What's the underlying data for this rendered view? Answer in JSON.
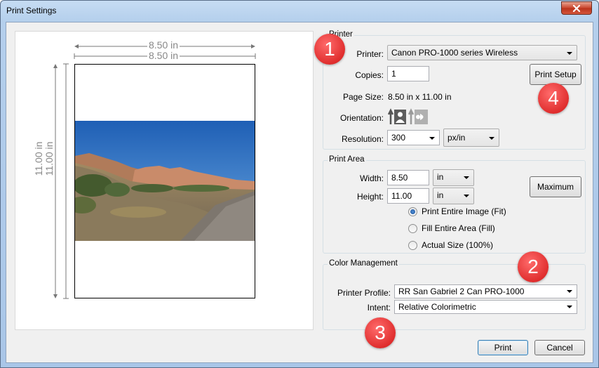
{
  "window": {
    "title": "Print Settings"
  },
  "preview": {
    "width_label": "8.50 in",
    "width_label_2": "8.50 in",
    "height_label": "11.00 in",
    "height_label_2": "11.00 in"
  },
  "printer_group": {
    "label": "Printer",
    "printer_label": "Printer:",
    "printer_value": "Canon PRO-1000 series Wireless",
    "copies_label": "Copies:",
    "copies_value": "1",
    "page_size_label": "Page Size:",
    "page_size_value": "8.50 in x 11.00 in",
    "orientation_label": "Orientation:",
    "resolution_label": "Resolution:",
    "resolution_value": "300",
    "resolution_unit": "px/in",
    "print_setup_button": "Print Setup"
  },
  "print_area": {
    "label": "Print Area",
    "width_label": "Width:",
    "width_value": "8.50",
    "width_unit": "in",
    "height_label": "Height:",
    "height_value": "11.00",
    "height_unit": "in",
    "maximum_button": "Maximum",
    "options": [
      "Print Entire Image (Fit)",
      "Fill Entire Area (Fill)",
      "Actual Size (100%)"
    ],
    "selected": 0
  },
  "color_management": {
    "label": "Color Management",
    "profile_label": "Printer Profile:",
    "profile_value": "RR San Gabriel 2 Can PRO-1000",
    "intent_label": "Intent:",
    "intent_value": "Relative Colorimetric"
  },
  "buttons": {
    "print": "Print",
    "cancel": "Cancel"
  },
  "badges": [
    "1",
    "2",
    "3",
    "4"
  ],
  "colors": {
    "badge": "#e02e2e",
    "title_bar": "#b4cfec"
  }
}
